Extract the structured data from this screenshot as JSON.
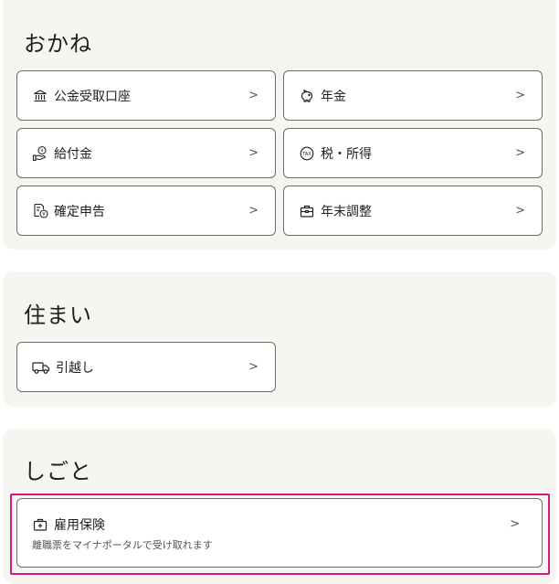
{
  "money": {
    "title": "おかね",
    "items": [
      {
        "label": "公金受取口座",
        "icon": "bank-icon"
      },
      {
        "label": "年金",
        "icon": "piggy-bank-icon"
      },
      {
        "label": "給付金",
        "icon": "hand-yen-icon"
      },
      {
        "label": "税・所得",
        "icon": "tax-icon"
      },
      {
        "label": "確定申告",
        "icon": "document-yen-icon"
      },
      {
        "label": "年末調整",
        "icon": "briefcase-icon"
      }
    ]
  },
  "home": {
    "title": "住まい",
    "items": [
      {
        "label": "引越し",
        "icon": "truck-icon"
      }
    ]
  },
  "work": {
    "title": "しごと",
    "items": [
      {
        "label": "雇用保険",
        "description": "離職票をマイナポータルで受け取れます",
        "icon": "briefcase-plus-icon"
      }
    ]
  },
  "chevron": ">"
}
